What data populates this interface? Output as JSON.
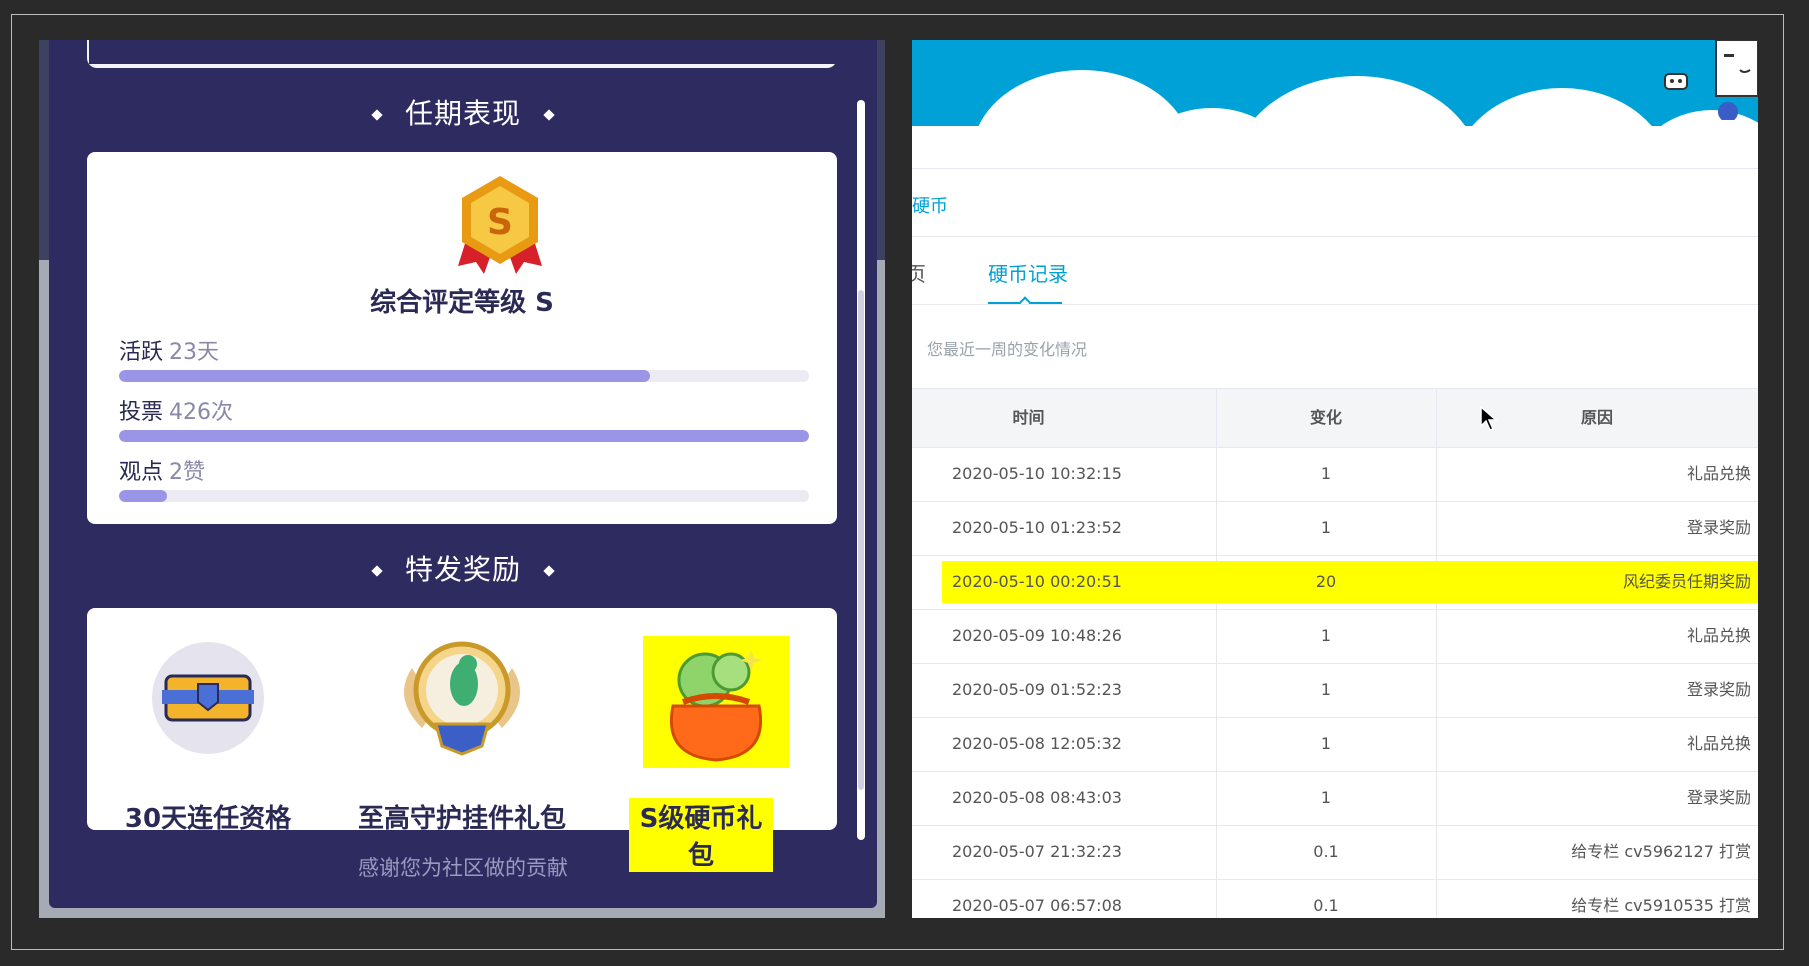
{
  "left_panel": {
    "performance_title": "任期表现",
    "rank_label": "综合评定等级 S",
    "stats": [
      {
        "label": "活跃",
        "value": "23天",
        "fill_percent": 77
      },
      {
        "label": "投票",
        "value": "426次",
        "fill_percent": 100
      },
      {
        "label": "观点",
        "value": "2赞",
        "fill_percent": 7
      }
    ],
    "rewards_title": "特发奖励",
    "rewards": [
      {
        "label": "30天连任资格",
        "icon": "ticket-icon"
      },
      {
        "label": "至高守护挂件礼包",
        "icon": "guardian-badge-icon"
      },
      {
        "label": "S级硬币礼包",
        "icon": "coin-bag-icon"
      }
    ],
    "thanks": "感谢您为社区做的贡献",
    "colors": {
      "panel_bg": "#2e2b60",
      "bar_fill": "#9a95e6",
      "bar_track": "#eceaf3"
    }
  },
  "right_panel": {
    "breadcrumb": "硬币",
    "tabs": [
      {
        "label": "页",
        "active": false
      },
      {
        "label": "硬币记录",
        "active": true
      }
    ],
    "subtitle": "您最近一周的变化情况",
    "columns": [
      "时间",
      "变化",
      "原因"
    ],
    "rows": [
      {
        "time": "2020-05-10 10:32:15",
        "change": "1",
        "reason": "礼品兑换",
        "highlighted": false
      },
      {
        "time": "2020-05-10 01:23:52",
        "change": "1",
        "reason": "登录奖励",
        "highlighted": false
      },
      {
        "time": "2020-05-10 00:20:51",
        "change": "20",
        "reason": "风纪委员任期奖励",
        "highlighted": true
      },
      {
        "time": "2020-05-09 10:48:26",
        "change": "1",
        "reason": "礼品兑换",
        "highlighted": false
      },
      {
        "time": "2020-05-09 01:52:23",
        "change": "1",
        "reason": "登录奖励",
        "highlighted": false
      },
      {
        "time": "2020-05-08 12:05:32",
        "change": "1",
        "reason": "礼品兑换",
        "highlighted": false
      },
      {
        "time": "2020-05-08 08:43:03",
        "change": "1",
        "reason": "登录奖励",
        "highlighted": false
      },
      {
        "time": "2020-05-07 21:32:23",
        "change": "0.1",
        "reason": "给专栏 cv5962127 打赏",
        "highlighted": false
      },
      {
        "time": "2020-05-07 06:57:08",
        "change": "0.1",
        "reason": "给专栏 cv5910535 打赏",
        "highlighted": false
      }
    ],
    "colors": {
      "accent": "#00a1d6",
      "highlight": "#ffff00"
    }
  }
}
